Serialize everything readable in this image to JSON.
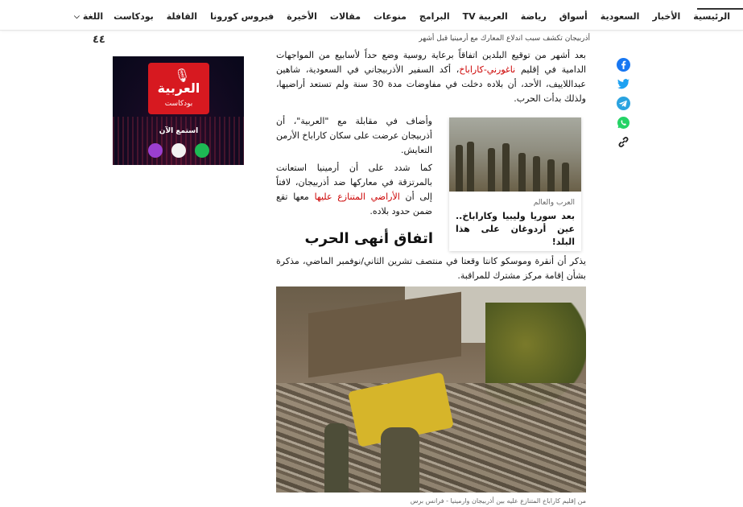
{
  "nav": {
    "items": [
      "الرئيسية",
      "الأخبار",
      "السعودية",
      "أسواق",
      "رياضة",
      "العربية TV",
      "البرامج",
      "منوعات",
      "مقالات",
      "الأخيرة",
      "فيروس كورونا",
      "القافلة",
      "بودكاست"
    ],
    "language_label": "اللغة"
  },
  "ticker": {
    "text": "أذربيجان تكشف سبب اندلاع المعارك مع أرمينيا قبل أشهر",
    "logo_text": "٤٤"
  },
  "ad": {
    "brand": "العربية",
    "subtitle": "بودكاست",
    "listen_label": "استمع الآن"
  },
  "share": {
    "icons": [
      "facebook-icon",
      "twitter-icon",
      "telegram-icon",
      "whatsapp-icon",
      "link-icon"
    ]
  },
  "article": {
    "p1_before": "بعد أشهر من توقيع البلدين اتفاقاً برعاية روسية وضع حداً لأسابيع من المواجهات الدامية في إقليم ",
    "p1_link": "ناغورني-كاراباخ",
    "p1_after": "، أكد السفير الأذربيجاني في السعودية، شاهين عبداللاييف، الأحد، أن بلاده دخلت في مفاوضات مدة 30 سنة ولم تستعد أراضيها، ولذلك بدأت الحرب.",
    "p2": "وأضاف في مقابلة مع \"العربية\"، أن أذربيجان عرضت على سكان كاراباخ الأرمن التعايش.",
    "p3_before": "كما شدد على أن أرمينيا استعانت بالمرتزقة في معاركها ضد أذربيجان، لافتاً إلى أن ",
    "p3_link": "الأراضي المتنازع عليها",
    "p3_after": " معها تقع ضمن حدود بلاده.",
    "heading": "اتفاق أنهى الحرب",
    "p4": "يذكر أن أنقرة وموسكو كانتا وقعتا في منتصف تشرين الثاني/نوفمبر الماضي، مذكرة بشأن إقامة مركز مشترك للمراقبة.",
    "caption": "من إقليم كاراباخ المتنازع عليه بين أذربيجان وارمينيا - فرانس برس"
  },
  "related_card": {
    "category": "العرب والعالم",
    "title": "بعد سوريا وليبيا وكاراباخ.. عين أردوغان على هذا البلد!"
  },
  "colors": {
    "link": "#cc0000",
    "ad_red": "#d71920"
  }
}
